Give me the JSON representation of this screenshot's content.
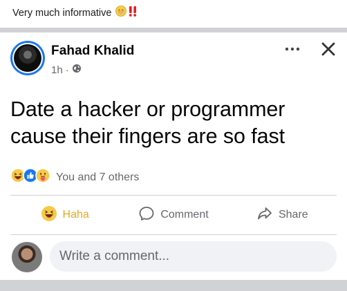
{
  "caption": {
    "text": "Very much informative",
    "icons": [
      "grinning-face-icon",
      "double-exclamation-icon"
    ]
  },
  "post": {
    "author": "Fahad Khalid",
    "time": "1h",
    "separator": "·",
    "privacy_icon": "globe-icon",
    "text": "Date a hacker or programmer cause their fingers are so fast",
    "reactions": {
      "icons": [
        "haha-icon",
        "like-icon",
        "care-icon"
      ],
      "summary": "You and 7 others"
    },
    "actions": {
      "haha_label": "Haha",
      "comment_label": "Comment",
      "share_label": "Share"
    },
    "comment_placeholder": "Write a comment..."
  },
  "colors": {
    "accent_blue": "#1877f2",
    "haha_yellow": "#e8a71e",
    "secondary_text": "#65676b",
    "divider": "#ced0d4",
    "separator_bar": "#d0d2d6"
  }
}
